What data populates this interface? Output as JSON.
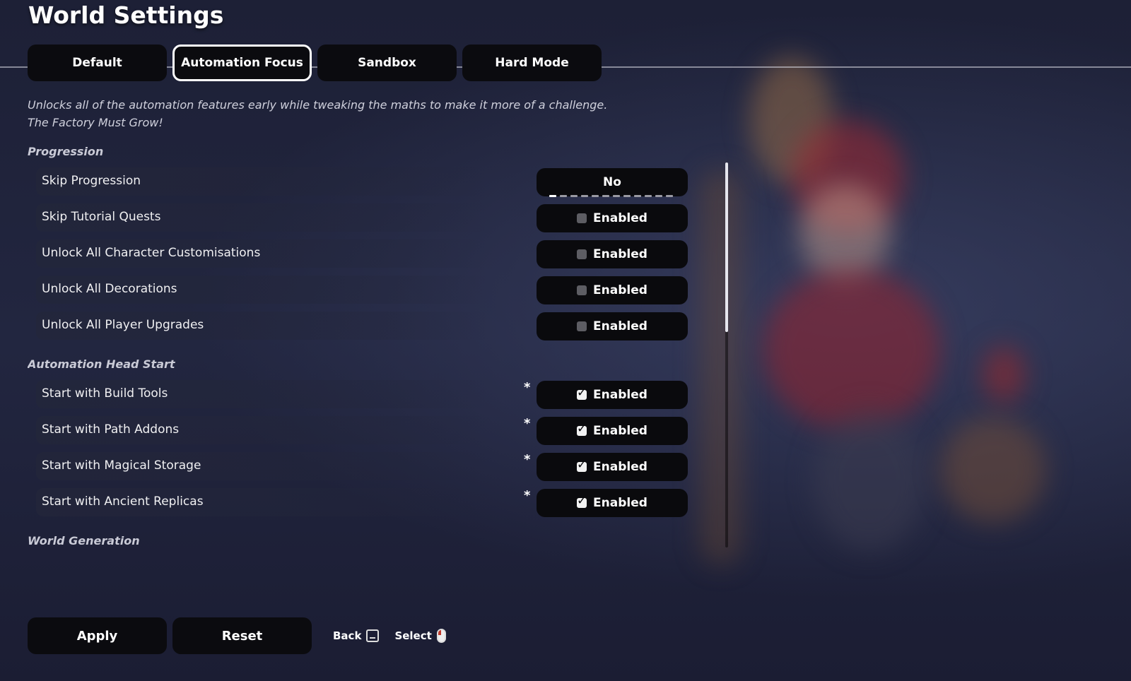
{
  "page": {
    "title": "World Settings"
  },
  "tabs": [
    {
      "label": "Default",
      "active": false
    },
    {
      "label": "Automation Focus",
      "active": true
    },
    {
      "label": "Sandbox",
      "active": false
    },
    {
      "label": "Hard Mode",
      "active": false
    }
  ],
  "description": {
    "line1": "Unlocks all of the automation features early while tweaking the maths to make it more of a challenge.",
    "line2": "The Factory Must Grow!"
  },
  "sections": {
    "progression": {
      "title": "Progression",
      "rows": [
        {
          "label": "Skip Progression",
          "control": "selector",
          "value": "No",
          "option_count": 12,
          "selected_index": 0
        },
        {
          "label": "Skip Tutorial Quests",
          "control": "checkbox",
          "value": "Enabled",
          "checked": false
        },
        {
          "label": "Unlock All Character Customisations",
          "control": "checkbox",
          "value": "Enabled",
          "checked": false
        },
        {
          "label": "Unlock All Decorations",
          "control": "checkbox",
          "value": "Enabled",
          "checked": false
        },
        {
          "label": "Unlock All Player Upgrades",
          "control": "checkbox",
          "value": "Enabled",
          "checked": false
        }
      ]
    },
    "automation": {
      "title": "Automation Head Start",
      "rows": [
        {
          "label": "Start with Build Tools",
          "marker": "*",
          "control": "checkbox",
          "value": "Enabled",
          "checked": true
        },
        {
          "label": "Start with Path Addons",
          "marker": "*",
          "control": "checkbox",
          "value": "Enabled",
          "checked": true
        },
        {
          "label": "Start with Magical Storage",
          "marker": "*",
          "control": "checkbox",
          "value": "Enabled",
          "checked": true
        },
        {
          "label": "Start with Ancient Replicas",
          "marker": "*",
          "control": "checkbox",
          "value": "Enabled",
          "checked": true
        }
      ]
    },
    "world_generation": {
      "title": "World Generation"
    }
  },
  "bottom": {
    "apply_label": "Apply",
    "reset_label": "Reset",
    "back_hint": "Back",
    "select_hint": "Select"
  },
  "icons": {
    "back": "keyboard-key-icon",
    "select": "mouse-left-click-icon"
  },
  "colors": {
    "background": "#1f2238",
    "button": "#0b0b0f",
    "text": "#ffffff",
    "checked": "#f2f2f2",
    "unchecked": "#5d5d63"
  }
}
